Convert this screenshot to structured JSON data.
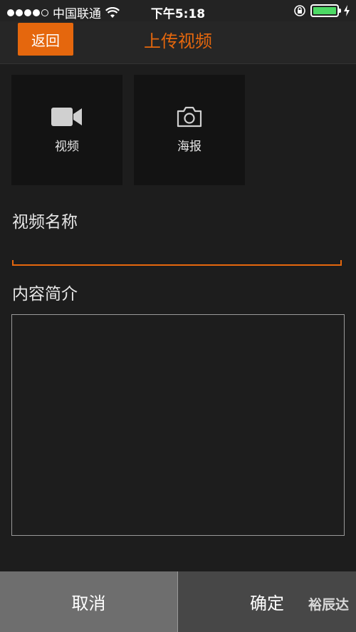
{
  "status_bar": {
    "carrier": "中国联通",
    "time": "下午5:18",
    "battery_level": 1.0
  },
  "nav": {
    "back_label": "返回",
    "title": "上传视频"
  },
  "media": {
    "video_label": "视频",
    "poster_label": "海报"
  },
  "form": {
    "name_label": "视频名称",
    "name_value": "",
    "description_label": "内容简介",
    "description_value": ""
  },
  "actions": {
    "cancel_label": "取消",
    "confirm_label": "确定"
  },
  "watermark": "裕辰达",
  "colors": {
    "accent": "#e5670d",
    "background": "#1d1d1d",
    "battery": "#4cd964"
  },
  "icons": [
    "signal-dots-icon",
    "wifi-icon",
    "rotation-lock-icon",
    "battery-icon",
    "charging-bolt-icon",
    "video-camera-icon",
    "photo-camera-icon"
  ]
}
